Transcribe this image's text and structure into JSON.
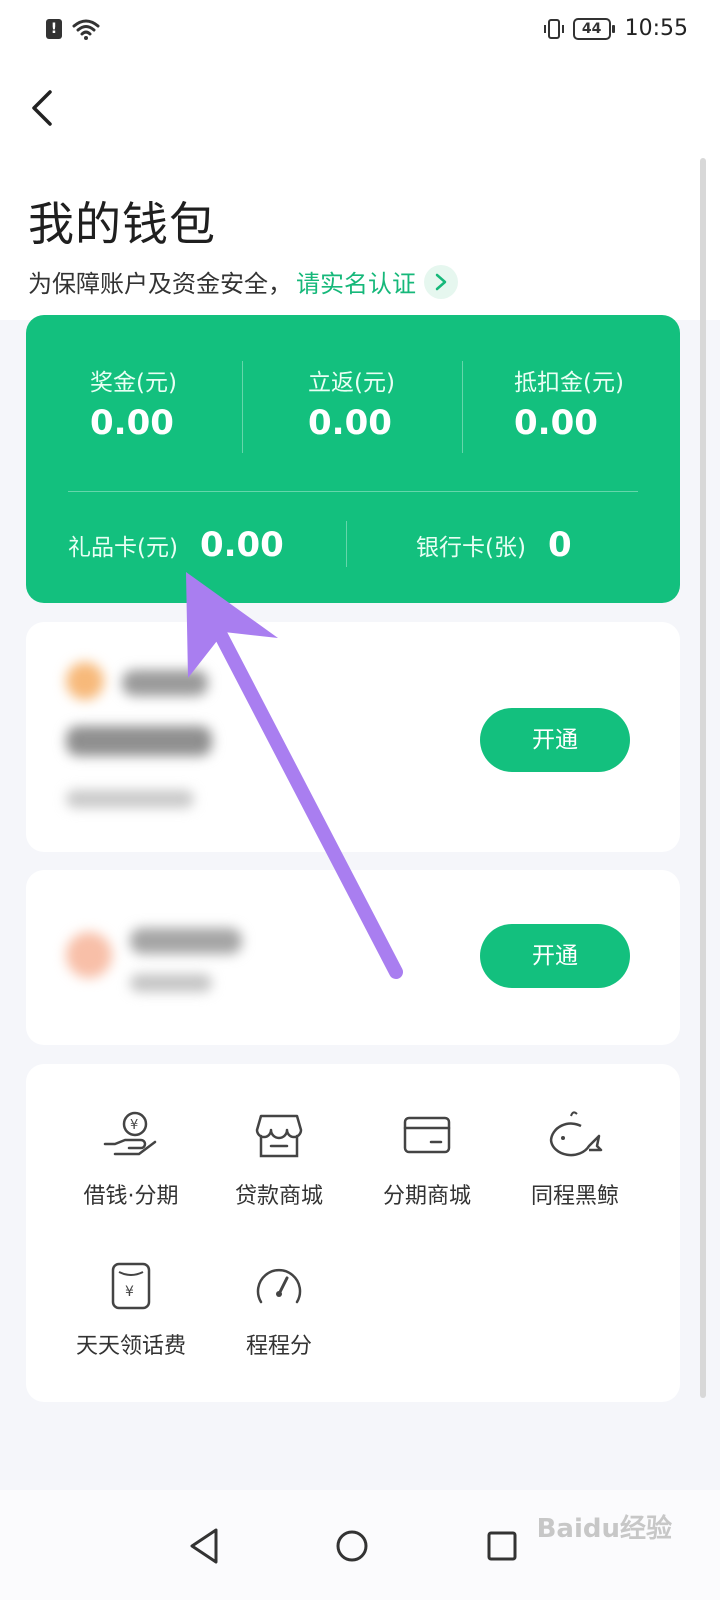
{
  "status_bar": {
    "time": "10:55",
    "battery": "44"
  },
  "header": {
    "title": "我的钱包",
    "security_text": "为保障账户及资金安全，",
    "verify_link": "请实名认证"
  },
  "wallet": {
    "stats": [
      {
        "label": "奖金(元)",
        "value": "0.00"
      },
      {
        "label": "立返(元)",
        "value": "0.00"
      },
      {
        "label": "抵扣金(元)",
        "value": "0.00"
      }
    ],
    "gift_card": {
      "label": "礼品卡(元)",
      "value": "0.00"
    },
    "bank_card": {
      "label": "银行卡(张)",
      "value": "0"
    }
  },
  "services": [
    {
      "button": "开通"
    },
    {
      "button": "开通"
    }
  ],
  "grid": [
    {
      "label": "借钱·分期",
      "icon": "borrow-money-icon"
    },
    {
      "label": "贷款商城",
      "icon": "loan-mall-icon"
    },
    {
      "label": "分期商城",
      "icon": "installment-mall-icon"
    },
    {
      "label": "同程黑鲸",
      "icon": "whale-icon"
    },
    {
      "label": "天天领话费",
      "icon": "phone-bill-icon"
    },
    {
      "label": "程程分",
      "icon": "score-gauge-icon"
    }
  ],
  "watermark": "Baidu经验",
  "colors": {
    "accent": "#13c07e",
    "annotation": "#a97ef0"
  }
}
